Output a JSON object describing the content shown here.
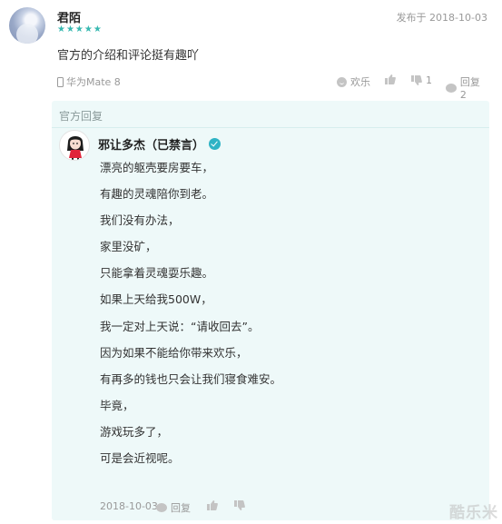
{
  "comment": {
    "username": "君陌",
    "rating_stars": 5,
    "stars": "★★★★★",
    "date": "发布于 2018-10-03",
    "text": "官方的介绍和评论挺有趣吖",
    "device": "华为Mate 8",
    "actions": {
      "fun_label": "欢乐",
      "like_count": "",
      "dislike_count": "1",
      "reply_label": "回复 2"
    }
  },
  "official_reply": {
    "label": "官方回复",
    "author": "邪让多杰（已禁言）",
    "lines": [
      "漂亮的躯壳要房要车，",
      "有趣的灵魂陪你到老。",
      "我们没有办法，",
      "家里没矿，",
      "只能拿着灵魂耍乐趣。",
      "如果上天给我500W，",
      "我一定对上天说：“请收回去”。",
      "因为如果不能给你带来欢乐，",
      "有再多的钱也只会让我们寝食难安。",
      "毕竟，",
      "游戏玩多了，",
      "可是会近视呢。"
    ],
    "date": "2018-10-03",
    "reply_label": "回复"
  },
  "watermark": "酷乐米",
  "colors": {
    "accent": "#37b8b0",
    "official_bg": "#eef9f9",
    "meta_gray": "#999999",
    "verify": "#2fb3c5"
  }
}
